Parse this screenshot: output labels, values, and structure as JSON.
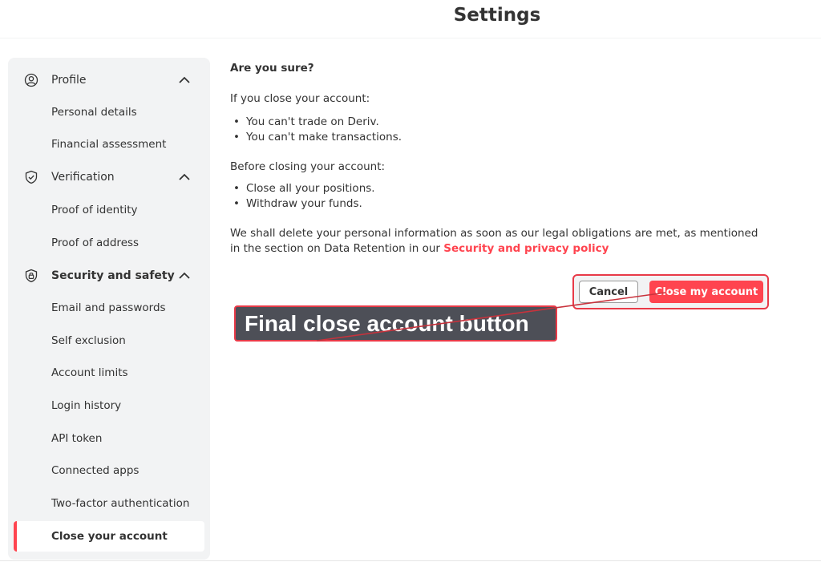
{
  "header": {
    "title": "Settings"
  },
  "sidebar": {
    "sections": [
      {
        "label": "Profile",
        "icon": "user-circle-icon",
        "items": [
          "Personal details",
          "Financial assessment"
        ]
      },
      {
        "label": "Verification",
        "icon": "shield-check-icon",
        "items": [
          "Proof of identity",
          "Proof of address"
        ]
      },
      {
        "label": "Security and safety",
        "icon": "shield-lock-icon",
        "items": [
          "Email and passwords",
          "Self exclusion",
          "Account limits",
          "Login history",
          "API token",
          "Connected apps",
          "Two-factor authentication",
          "Close your account"
        ]
      }
    ],
    "active_item": "Close your account"
  },
  "content": {
    "question": "Are you sure?",
    "if_close_heading": "If you close your account:",
    "if_close_bullets": [
      "You can't trade on Deriv.",
      "You can't make transactions."
    ],
    "before_heading": "Before closing your account:",
    "before_bullets": [
      "Close all your positions.",
      "Withdraw your funds."
    ],
    "retention_text": "We shall delete your personal information as soon as our legal obligations are met, as mentioned in the section on Data Retention in our ",
    "retention_link": "Security and privacy policy"
  },
  "actions": {
    "cancel_label": "Cancel",
    "close_label": "Close my account"
  },
  "annotation": {
    "callout_text": "Final close account button"
  },
  "colors": {
    "accent": "#ff444f",
    "sidebar_bg": "#f2f3f4",
    "callout_bg": "#4d4f57",
    "text": "#333333"
  }
}
